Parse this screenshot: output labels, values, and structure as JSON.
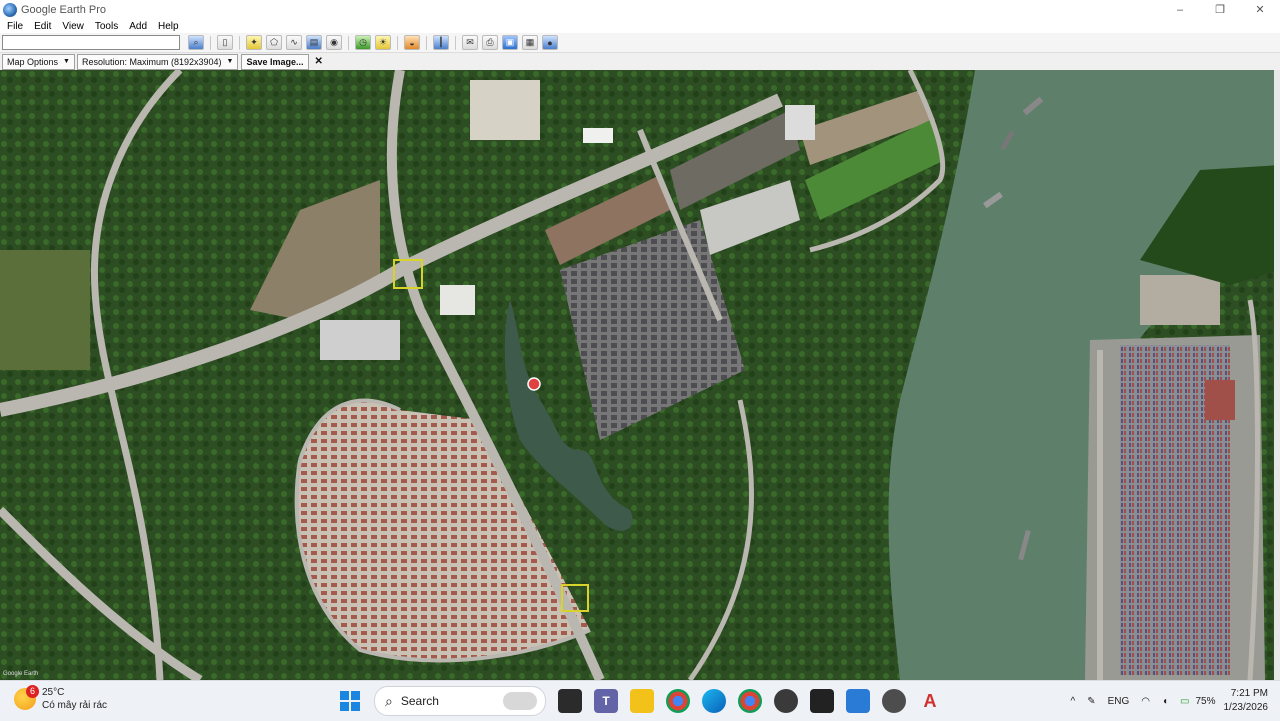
{
  "window": {
    "title": "Google Earth Pro",
    "controls": [
      "–",
      "❐",
      "✕"
    ]
  },
  "menu": [
    "File",
    "Edit",
    "View",
    "Tools",
    "Add",
    "Help"
  ],
  "toolbar": {
    "search_value": "",
    "icons": [
      "search-icon",
      "sidebar-icon",
      "placemark-icon",
      "polygon-icon",
      "path-icon",
      "overlay-icon",
      "record-tour-icon",
      "historical-imagery-icon",
      "sun-icon",
      "planets-icon",
      "ruler-icon",
      "email-icon",
      "print-icon",
      "save-image-icon",
      "view-in-maps-icon",
      "earth-icon"
    ]
  },
  "options_bar": {
    "map_options": "Map Options",
    "resolution": "Resolution: Maximum (8192x3904)",
    "save_image": "Save Image...",
    "close": "✕"
  },
  "map": {
    "watermark": "Google Earth"
  },
  "taskbar": {
    "weather": {
      "badge": "6",
      "temp": "25°C",
      "desc": "Có mây rải rác"
    },
    "search_label": "Search",
    "tray": {
      "language": "ENG",
      "battery": "75%",
      "time": "7:21 PM",
      "date": "1/23/2026"
    }
  },
  "colors": {
    "water": "#5e7f6a",
    "forest": "#2d4d22",
    "road": "#b9b7b0",
    "roof": "#a05a4c"
  }
}
